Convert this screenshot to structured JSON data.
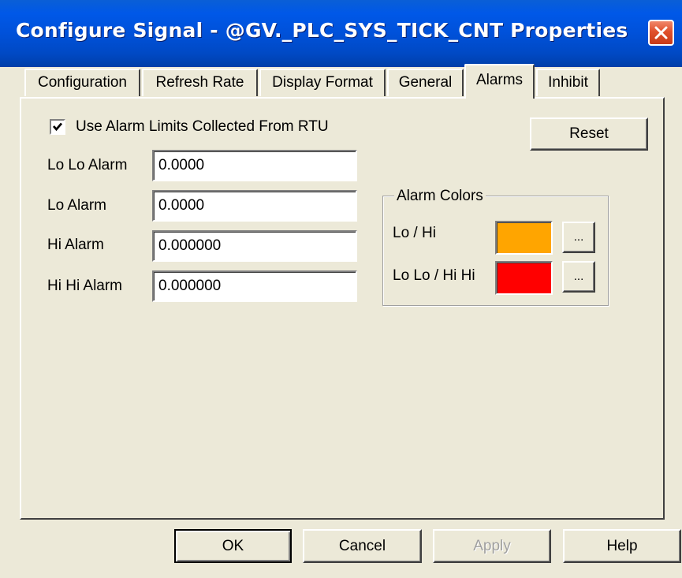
{
  "window": {
    "title": "Configure Signal - @GV._PLC_SYS_TICK_CNT Properties"
  },
  "tabs": [
    {
      "label": "Configuration",
      "active": false
    },
    {
      "label": "Refresh Rate",
      "active": false
    },
    {
      "label": "Display Format",
      "active": false
    },
    {
      "label": "General",
      "active": false
    },
    {
      "label": "Alarms",
      "active": true
    },
    {
      "label": "Inhibit",
      "active": false
    }
  ],
  "alarms": {
    "use_rtu_limits": {
      "label": "Use Alarm Limits Collected From RTU",
      "checked": true
    },
    "reset_label": "Reset",
    "fields": [
      {
        "label": "Lo Lo Alarm",
        "value": "0.0000"
      },
      {
        "label": "Lo Alarm",
        "value": "0.0000"
      },
      {
        "label": "Hi Alarm",
        "value": "0.000000"
      },
      {
        "label": "Hi Hi Alarm",
        "value": "0.000000"
      }
    ],
    "colors": {
      "title": "Alarm Colors",
      "items": [
        {
          "label": "Lo / Hi",
          "color": "#ffa500",
          "button": "..."
        },
        {
          "label": "Lo Lo / Hi Hi",
          "color": "#ff0000",
          "button": "..."
        }
      ]
    }
  },
  "buttons": {
    "ok": "OK",
    "cancel": "Cancel",
    "apply": "Apply",
    "help": "Help"
  }
}
